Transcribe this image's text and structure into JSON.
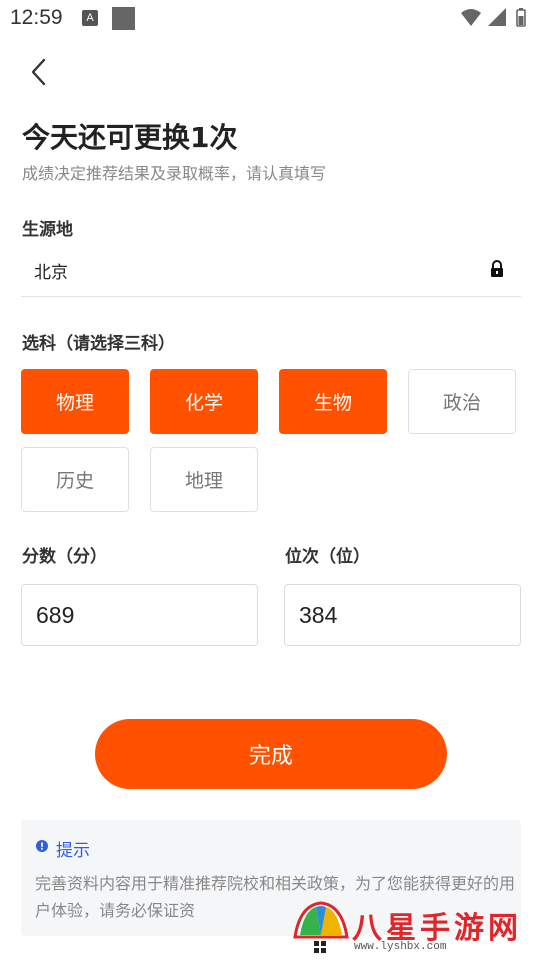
{
  "status_bar": {
    "time": "12:59",
    "notification_icon": "A"
  },
  "header": {
    "back_icon": "chevron-left-icon"
  },
  "title": "今天还可更换1次",
  "subtitle": "成绩决定推荐结果及录取概率，请认真填写",
  "origin": {
    "label": "生源地",
    "value": "北京",
    "lock_icon": "lock-icon"
  },
  "subjects": {
    "label": "选科（请选择三科）",
    "items": [
      {
        "name": "物理",
        "selected": true
      },
      {
        "name": "化学",
        "selected": true
      },
      {
        "name": "生物",
        "selected": true
      },
      {
        "name": "政治",
        "selected": false
      },
      {
        "name": "历史",
        "selected": false
      },
      {
        "name": "地理",
        "selected": false
      }
    ]
  },
  "score": {
    "label": "分数（分）",
    "value": "689"
  },
  "rank": {
    "label": "位次（位）",
    "value": "384"
  },
  "done_button": "完成",
  "tip": {
    "title": "提示",
    "text": "完善资料内容用于精准推荐院校和相关政策，为了您能获得更好的用户体验，请务必保证资"
  },
  "watermark": {
    "text": "八星手游网",
    "url": "www.lyshbx.com"
  },
  "colors": {
    "accent": "#ff5100",
    "tip_blue": "#2f5fe0",
    "watermark_red": "#e0262a"
  }
}
